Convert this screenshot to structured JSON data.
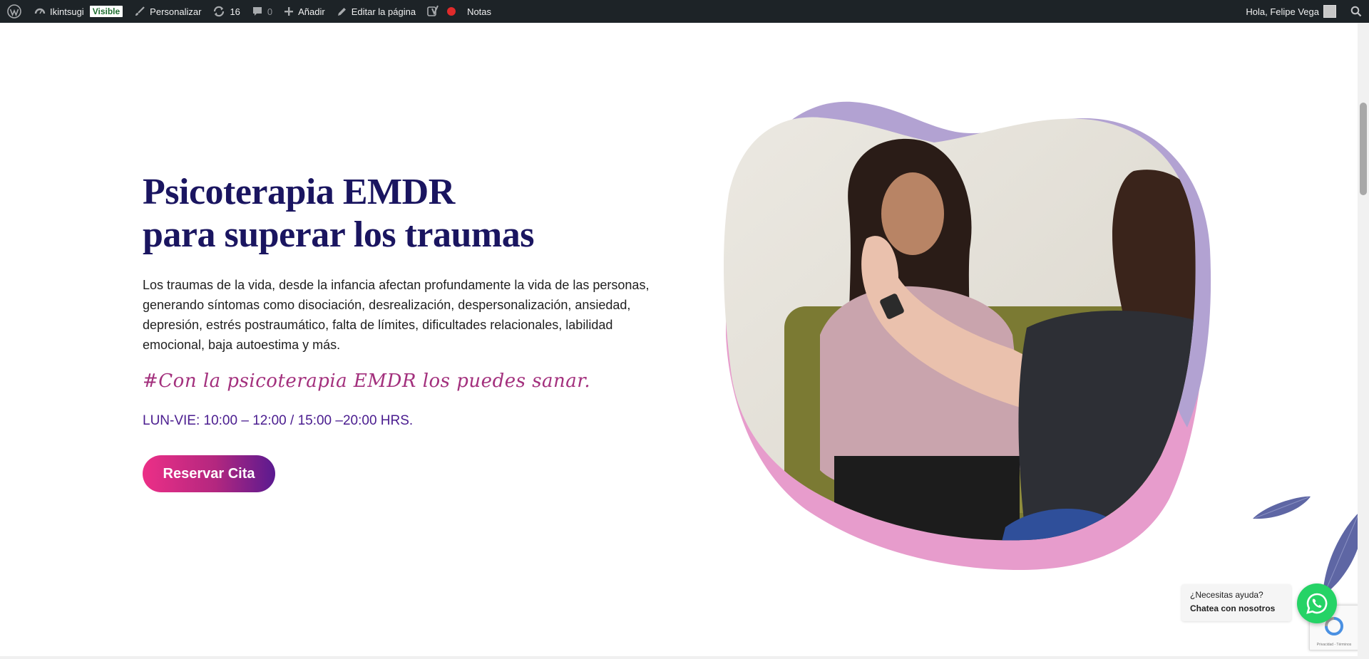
{
  "adminbar": {
    "site_name": "Ikintsugi",
    "visibility_badge": "Visible",
    "customize_label": "Personalizar",
    "updates_count": "16",
    "comments_count": "0",
    "add_label": "Añadir",
    "edit_page_label": "Editar la página",
    "notes_label": "Notas",
    "greeting": "Hola, Felipe Vega",
    "icons": [
      "wordpress-icon",
      "dashboard-icon",
      "brush-icon",
      "updates-icon",
      "comment-icon",
      "plus-icon",
      "pencil-icon",
      "yoast-icon",
      "status-dot-icon",
      "search-icon"
    ],
    "status_color": "#e02b2b"
  },
  "hero": {
    "title_line1": "Psicoterapia EMDR",
    "title_line2": "para superar los traumas",
    "intro": "Los traumas de la vida, desde la infancia afectan profundamente la vida de las personas, generando síntomas como disociación, desrealización, despersonalización, ansiedad, depresión, estrés postraumático, falta de límites, dificultades relacionales, labilidad emocional, baja autoestima y más.",
    "tagline": "#Con la psicoterapia EMDR los puedes sanar.",
    "hours": "LUN-VIE: 10:00 – 12:00 / 15:00 –20:00 HRS.",
    "cta_label": "Reservar Cita",
    "colors": {
      "title": "#1a1560",
      "tagline": "#a3307d",
      "hours": "#4a1c8f",
      "cta_start": "#ec2f87",
      "cta_end": "#5a1a90",
      "blob_lavender": "#b2a2d2",
      "blob_pink": "#e79ccc",
      "leaf": "#5e66a4"
    }
  },
  "chat": {
    "line1": "¿Necesitas ayuda?",
    "line2": "Chatea con nosotros",
    "button_icon": "whatsapp-icon",
    "button_color": "#25d366"
  },
  "recaptcha": {
    "terms": "Privacidad - Términos"
  }
}
